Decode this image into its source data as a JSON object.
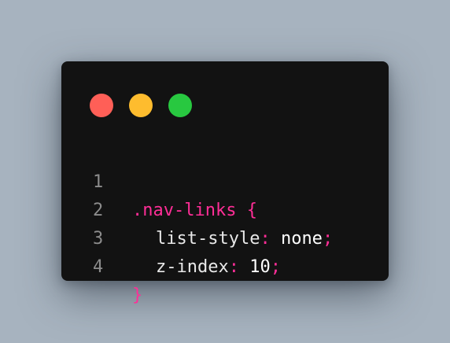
{
  "colors": {
    "background": "#a7b3bf",
    "window": "#121212",
    "dot_red": "#ff5f57",
    "dot_yellow": "#febc2e",
    "dot_green": "#28c840",
    "accent_pink": "#ff2e97",
    "line_number": "#8c8c8c",
    "text": "#ffffff"
  },
  "window_controls": {
    "close_icon": "red-circle",
    "minimize_icon": "yellow-circle",
    "maximize_icon": "green-circle"
  },
  "code": {
    "lines": [
      {
        "number": "1",
        "selector": ".nav-links",
        "brace": " {"
      },
      {
        "number": "2",
        "property": "list-style",
        "colon": ":",
        "value": " none",
        "semicolon": ";"
      },
      {
        "number": "3",
        "property": "z-index",
        "colon": ":",
        "value": " 10",
        "semicolon": ";"
      },
      {
        "number": "4",
        "brace": "}"
      }
    ]
  }
}
